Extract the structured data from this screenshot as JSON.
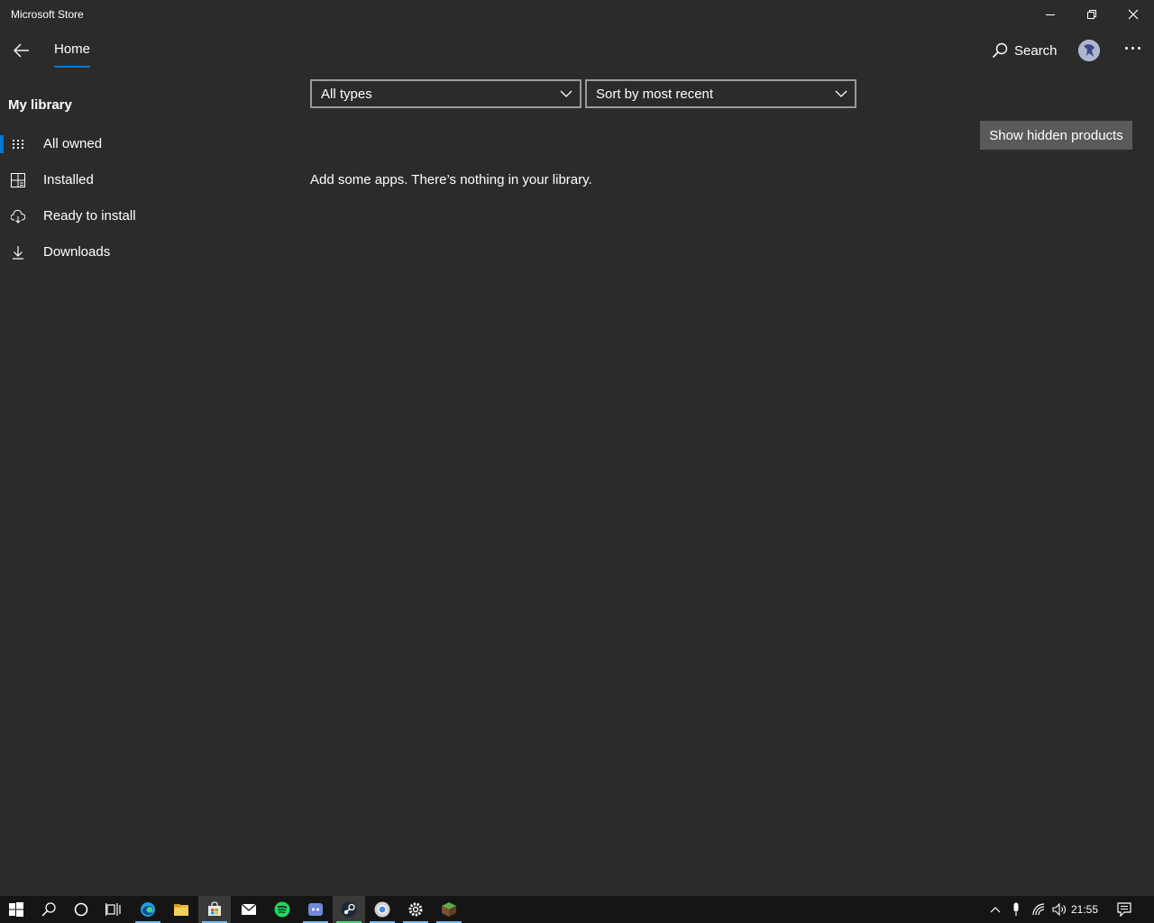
{
  "window": {
    "title": "Microsoft Store"
  },
  "nav": {
    "home_label": "Home",
    "search_label": "Search"
  },
  "sidebar": {
    "heading": "My library",
    "items": [
      {
        "label": "All owned",
        "icon": "grid-icon",
        "selected": true
      },
      {
        "label": "Installed",
        "icon": "installed-icon",
        "selected": false
      },
      {
        "label": "Ready to install",
        "icon": "cloud-download-icon",
        "selected": false
      },
      {
        "label": "Downloads",
        "icon": "download-icon",
        "selected": false
      }
    ]
  },
  "filters": {
    "type_selected": "All types",
    "sort_selected": "Sort by most recent"
  },
  "main": {
    "show_hidden_label": "Show hidden products",
    "empty_message": "Add some apps. There’s nothing in your library."
  },
  "taskbar": {
    "apps": [
      "windows-start-icon",
      "search-icon",
      "cortana-icon",
      "task-view-icon",
      "edge-icon",
      "file-explorer-icon",
      "store-icon",
      "mail-icon",
      "spotify-icon",
      "discord-icon",
      "steam-icon",
      "chrome-icon",
      "settings-icon",
      "minecraft-icon"
    ],
    "clock": "21:55"
  },
  "colors": {
    "accent": "#0078d7",
    "background": "#2b2b2b",
    "taskbar": "#151515"
  }
}
